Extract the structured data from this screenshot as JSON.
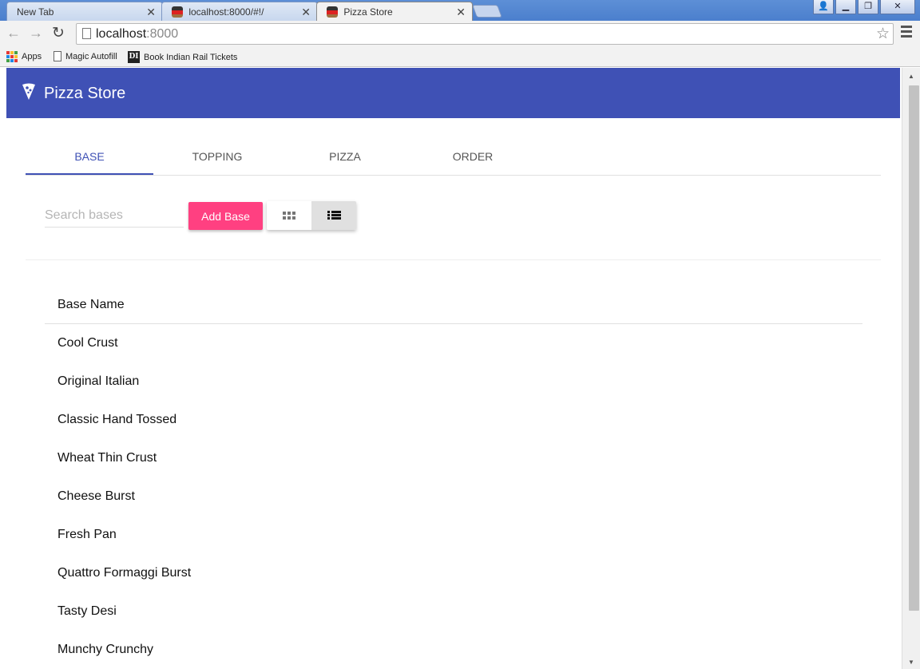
{
  "browser": {
    "tabs": [
      {
        "title": "New Tab",
        "active": false
      },
      {
        "title": "localhost:8000/#!/",
        "active": false
      },
      {
        "title": "Pizza Store",
        "active": true
      }
    ],
    "url_host": "localhost",
    "url_port": ":8000",
    "bookmarks": [
      "Apps",
      "Magic Autofill",
      "Book Indian Rail Tickets"
    ],
    "di_label": "DI"
  },
  "app": {
    "title": "Pizza Store",
    "accent_color": "#3f51b5",
    "button_color": "#ff4081",
    "tabs": [
      "Base",
      "Topping",
      "Pizza",
      "Order"
    ],
    "active_tab": "Base",
    "search_placeholder": "Search bases",
    "add_button": "Add Base",
    "view_modes": [
      "grid-icon",
      "list-icon"
    ],
    "active_view": "list",
    "table": {
      "header": "Base Name",
      "rows": [
        "Cool Crust",
        "Original Italian",
        "Classic Hand Tossed",
        "Wheat Thin Crust",
        "Cheese Burst",
        "Fresh Pan",
        "Quattro Formaggi Burst",
        "Tasty Desi",
        "Munchy Crunchy"
      ]
    }
  }
}
